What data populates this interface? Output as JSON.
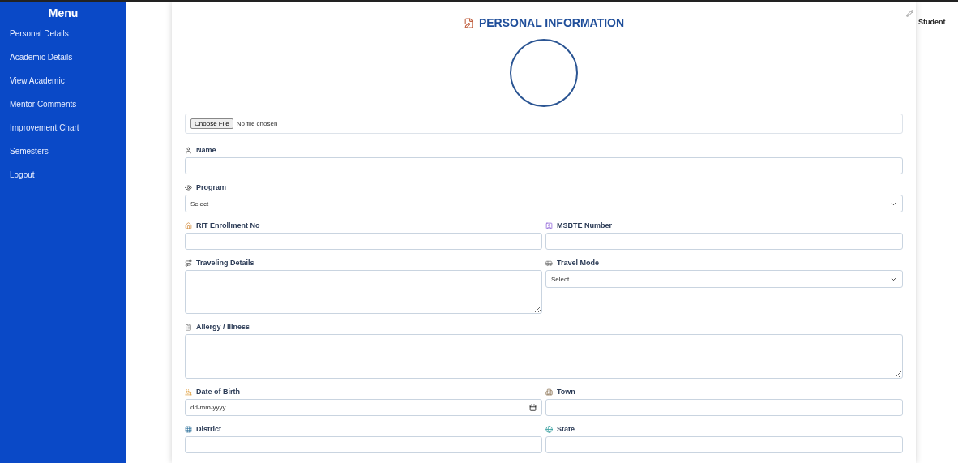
{
  "sidebar": {
    "title": "Menu",
    "items": [
      {
        "label": "Personal Details",
        "selected": false
      },
      {
        "label": "Academic Details",
        "selected": false
      },
      {
        "label": "View Academic",
        "selected": false
      },
      {
        "label": "Mentor Comments",
        "selected": false
      },
      {
        "label": "Improvement Chart",
        "selected": false
      },
      {
        "label": "Semesters",
        "selected": false
      },
      {
        "label": "Logout",
        "selected": false
      }
    ]
  },
  "header": {
    "user": "Student"
  },
  "form": {
    "title": "PERSONAL INFORMATION",
    "photo": {
      "button": "Choose File",
      "status": "No file chosen"
    },
    "fields": [
      {
        "label": "Name",
        "kind": "text",
        "wide": true
      },
      {
        "label": "Program",
        "kind": "select",
        "wide": true,
        "value": "Select"
      },
      {
        "label": "RIT Enrollment No",
        "kind": "text",
        "wide": false
      },
      {
        "label": "MSBTE Number",
        "kind": "text",
        "wide": false
      },
      {
        "label": "Traveling Details",
        "kind": "textarea",
        "wide": false
      },
      {
        "label": "Travel Mode",
        "kind": "select",
        "wide": false,
        "value": "Select"
      },
      {
        "label": "Allergy / Illness",
        "kind": "textarea",
        "wide": true
      },
      {
        "label": "Date of Birth",
        "kind": "date",
        "wide": false,
        "placeholder": "dd-mm-yyyy"
      },
      {
        "label": "Town",
        "kind": "text",
        "wide": false
      },
      {
        "label": "District",
        "kind": "text",
        "wide": false
      },
      {
        "label": "State",
        "kind": "text",
        "wide": false
      }
    ]
  }
}
